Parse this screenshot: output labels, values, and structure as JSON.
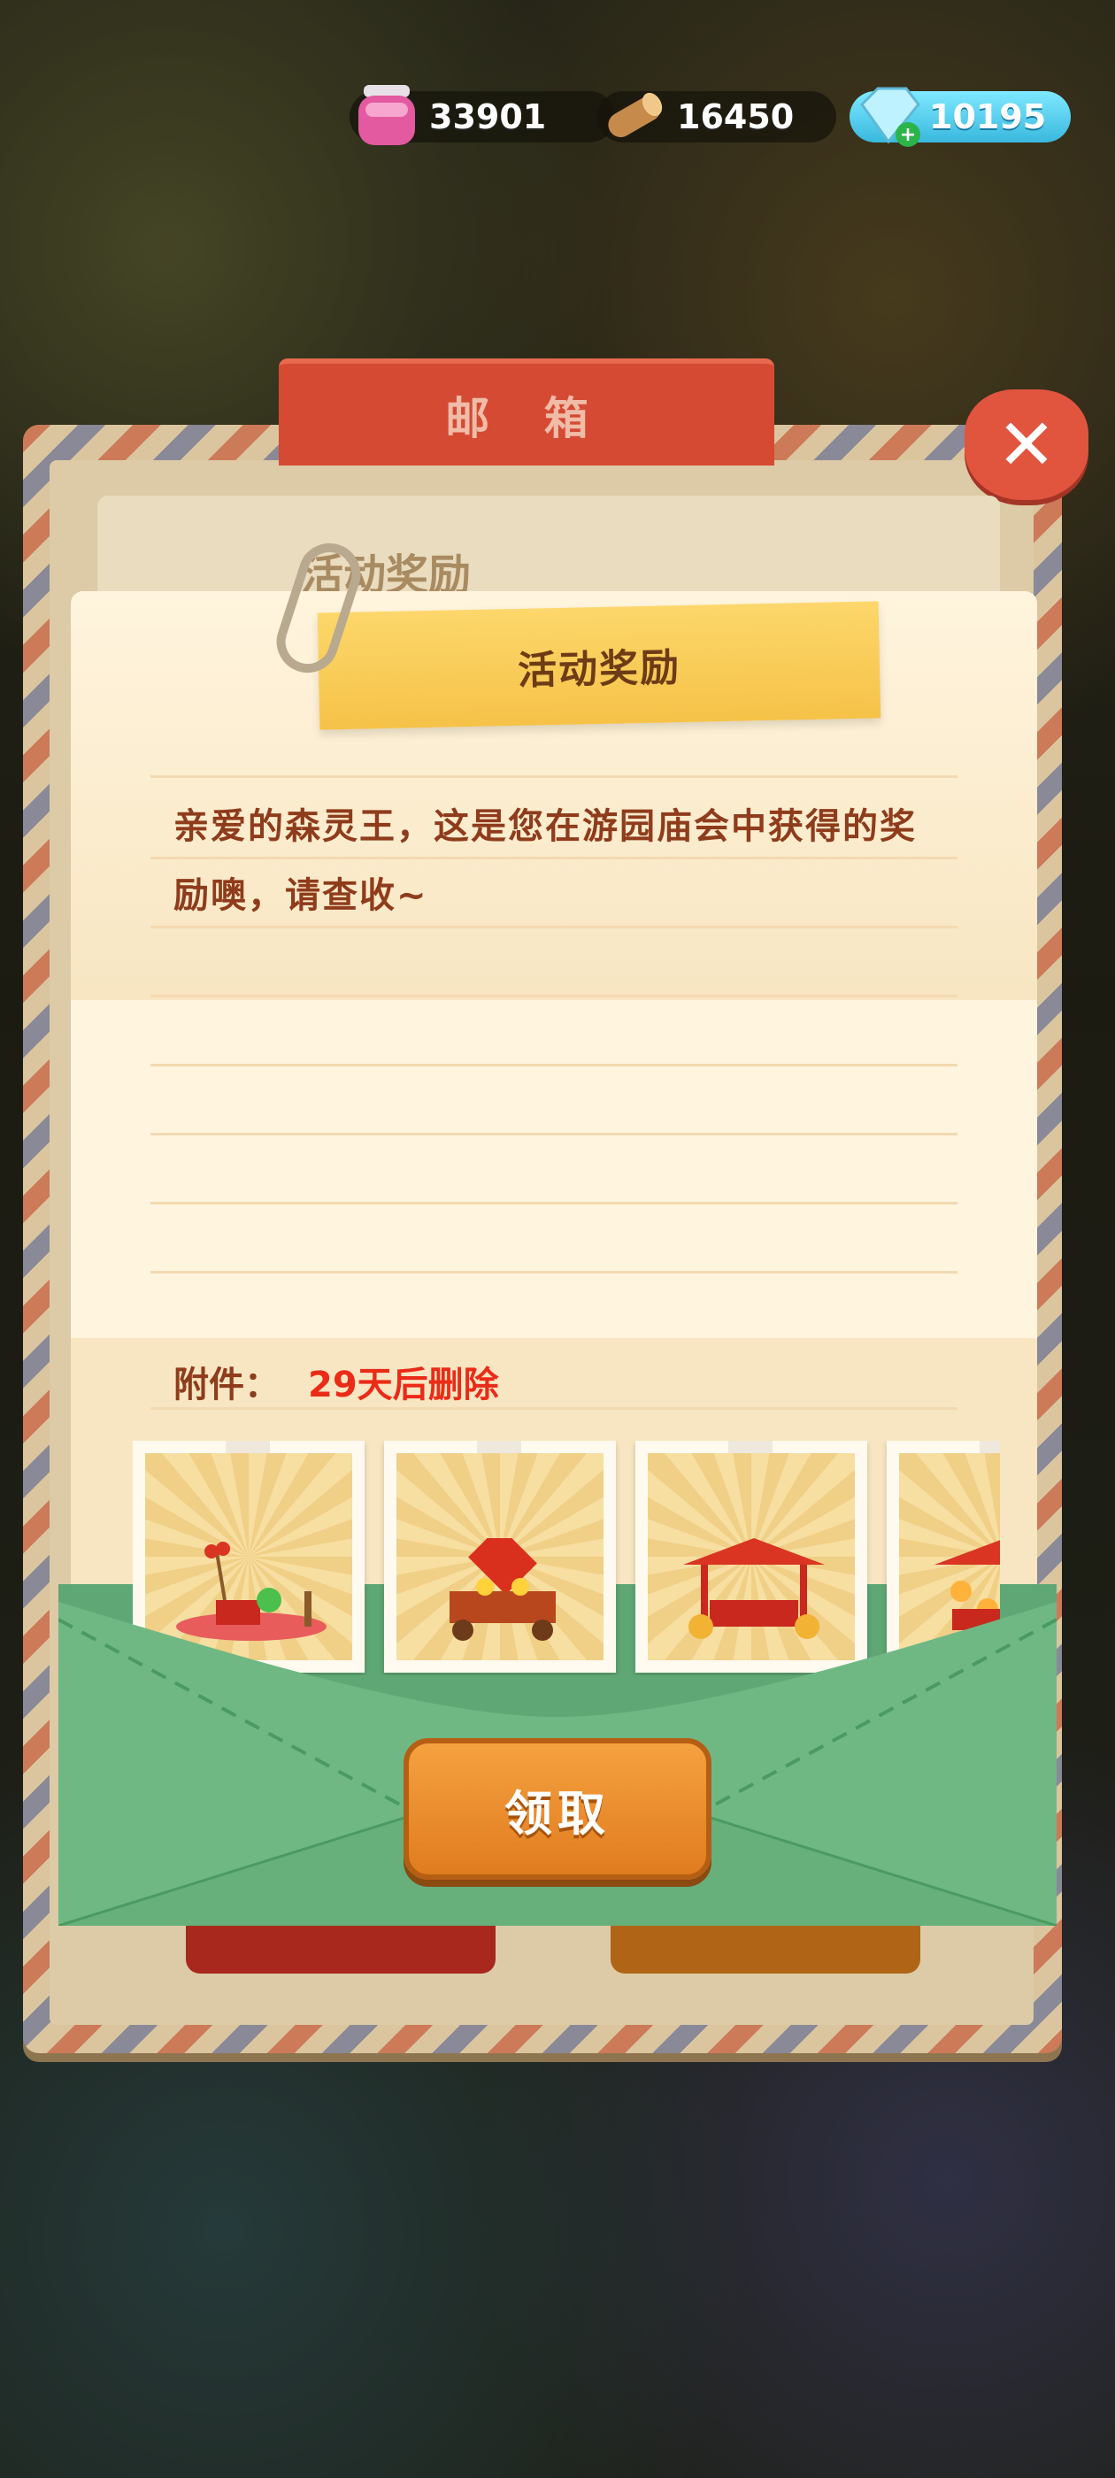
{
  "resources": {
    "jam": {
      "value": "33901",
      "icon": "jam-jar-icon"
    },
    "wood": {
      "value": "16450",
      "icon": "wood-log-icon"
    },
    "gem": {
      "value": "10195",
      "icon": "diamond-icon",
      "plus_icon": "plus-icon"
    }
  },
  "mailbox": {
    "tab_title": "邮 箱",
    "close_icon": "close-icon",
    "row_title": "活动奖励"
  },
  "letter": {
    "title": "活动奖励",
    "message": "亲爱的森灵王，这是您在游园庙会中获得的奖励噢，请查收~",
    "attachment_label": "附件：",
    "attachment_expire": "29天后删除",
    "items": [
      {
        "name": "candied-haw-stall"
      },
      {
        "name": "red-lantern-cart"
      },
      {
        "name": "temple-fair-booth"
      },
      {
        "name": "lantern-stand"
      }
    ]
  },
  "claim_button": "领取",
  "colors": {
    "accent": "#f5a140",
    "red_text": "#ea2b18",
    "brown_text": "#8e3c1c",
    "envelope": "#5fa774"
  }
}
